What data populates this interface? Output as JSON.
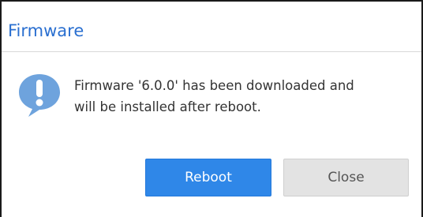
{
  "dialog": {
    "title": "Firmware",
    "message_line1": "Firmware '6.0.0' has been downloaded and",
    "message_line2": "will be installed after reboot.",
    "icon": "info-speech-bubble-icon"
  },
  "buttons": {
    "reboot_label": "Reboot",
    "close_label": "Close"
  },
  "colors": {
    "title": "#2a6fd0",
    "icon": "#6ea3dd",
    "primary_button": "#2f87e8",
    "secondary_button": "#e3e3e3"
  }
}
